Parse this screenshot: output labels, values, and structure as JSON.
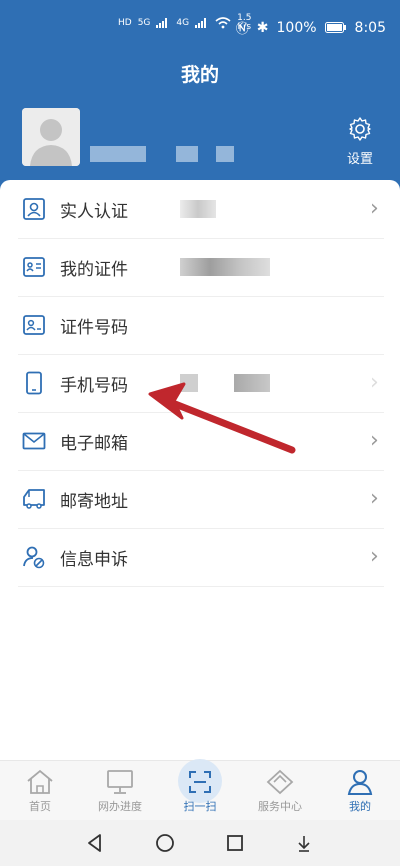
{
  "status_bar": {
    "network_speed_value": "1.5",
    "network_speed_unit": "K/s",
    "battery": "100%",
    "time": "8:05",
    "sim_labels": [
      "HD",
      "HD"
    ],
    "signal_labels": [
      "5G",
      "4G"
    ]
  },
  "header": {
    "title": "我的",
    "settings_label": "设置"
  },
  "menu": {
    "items": [
      {
        "label": "实人认证",
        "icon": "id-card-icon"
      },
      {
        "label": "我的证件",
        "icon": "document-card-icon"
      },
      {
        "label": "证件号码",
        "icon": "id-number-icon"
      },
      {
        "label": "手机号码",
        "icon": "phone-icon"
      },
      {
        "label": "电子邮箱",
        "icon": "mail-icon"
      },
      {
        "label": "邮寄地址",
        "icon": "truck-icon"
      },
      {
        "label": "信息申诉",
        "icon": "user-appeal-icon"
      }
    ]
  },
  "bottom_nav": {
    "items": [
      {
        "label": "首页",
        "icon": "home-icon"
      },
      {
        "label": "网办进度",
        "icon": "monitor-icon"
      },
      {
        "label": "扫一扫",
        "icon": "scan-icon"
      },
      {
        "label": "服务中心",
        "icon": "diamond-icon"
      },
      {
        "label": "我的",
        "icon": "user-icon"
      }
    ]
  },
  "colors": {
    "header_blue": "#2f6fb4",
    "icon_blue": "#2f6fb4",
    "arrow_red": "#c0272d"
  }
}
